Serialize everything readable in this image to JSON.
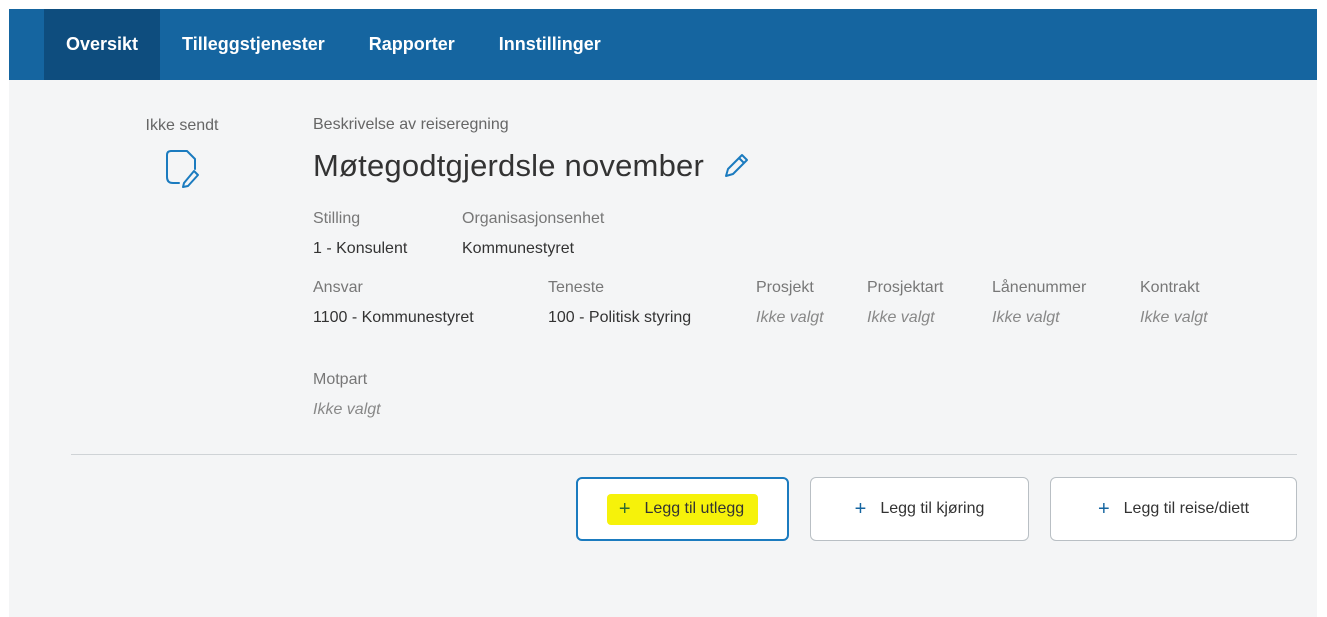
{
  "nav": {
    "tabs": [
      "Oversikt",
      "Tilleggstjenester",
      "Rapporter",
      "Innstillinger"
    ],
    "active": "Oversikt"
  },
  "status": {
    "label": "Ikke sendt",
    "icon": "draft-document-icon"
  },
  "report": {
    "description_label": "Beskrivelse av reiseregning",
    "title": "Møtegodtgjerdsle november",
    "edit_icon": "pencil-icon"
  },
  "fields": {
    "stilling": {
      "label": "Stilling",
      "value": "1 - Konsulent"
    },
    "organisasjonsenhet": {
      "label": "Organisasjonsenhet",
      "value": "Kommunestyret"
    },
    "ansvar": {
      "label": "Ansvar",
      "value": "1100 - Kommunestyret"
    },
    "teneste": {
      "label": "Teneste",
      "value": "100 - Politisk styring"
    },
    "prosjekt": {
      "label": "Prosjekt",
      "value": "Ikke valgt"
    },
    "prosjektart": {
      "label": "Prosjektart",
      "value": "Ikke valgt"
    },
    "lanenummer": {
      "label": "Lånenummer",
      "value": "Ikke valgt"
    },
    "kontrakt": {
      "label": "Kontrakt",
      "value": "Ikke valgt"
    },
    "motpart": {
      "label": "Motpart",
      "value": "Ikke valgt"
    }
  },
  "actions": {
    "plus": "+",
    "add_expense": "Legg til utlegg",
    "add_driving": "Legg til kjøring",
    "add_travel": "Legg til reise/diett"
  },
  "colors": {
    "nav_bg": "#1565a0",
    "nav_active": "#0e4d7e",
    "accent": "#1b7bbf",
    "highlight": "#f6f20a"
  }
}
